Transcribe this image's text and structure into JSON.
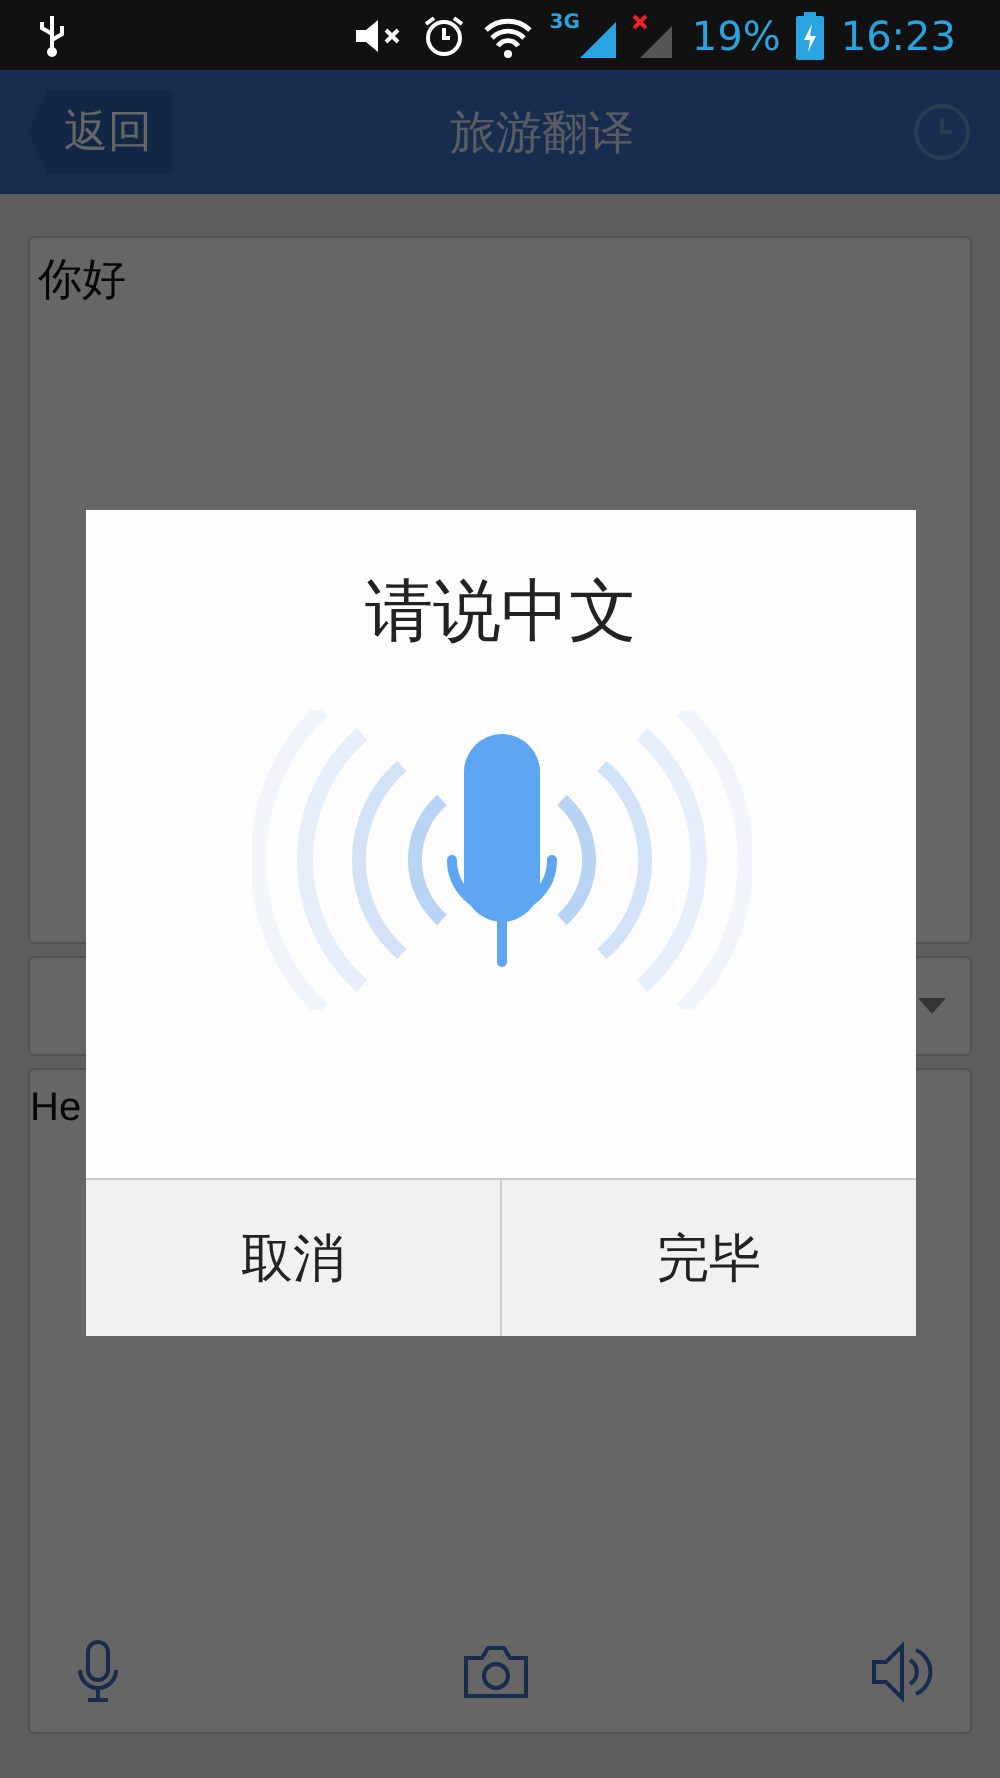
{
  "status_bar": {
    "network": "3G",
    "battery": "19%",
    "time": "16:23"
  },
  "header": {
    "back": "返回",
    "title": "旅游翻译"
  },
  "input": {
    "value": "你好"
  },
  "output": {
    "text": "He"
  },
  "dialog": {
    "title": "请说中文",
    "buttons": [
      "取消",
      "完毕"
    ]
  }
}
